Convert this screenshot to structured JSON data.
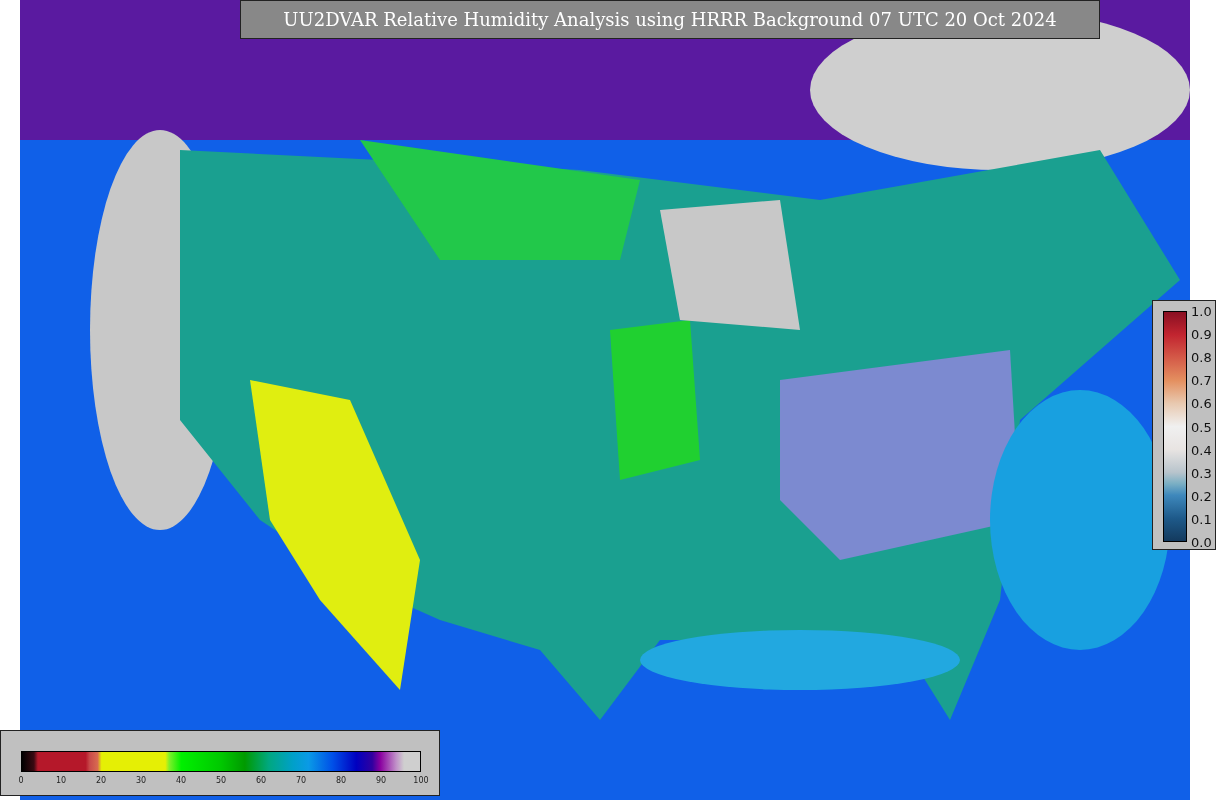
{
  "title": "UU2DVAR Relative Humidity Analysis using HRRR Background 07 UTC 20 Oct 2024",
  "vertical_colorbar": {
    "ticks": [
      "1.0",
      "0.9",
      "0.8",
      "0.7",
      "0.6",
      "0.5",
      "0.4",
      "0.3",
      "0.2",
      "0.1",
      "0.0"
    ]
  },
  "horizontal_colorbar": {
    "ticks": [
      "0",
      "10",
      "20",
      "30",
      "40",
      "50",
      "60",
      "70",
      "80",
      "90",
      "100"
    ]
  }
}
